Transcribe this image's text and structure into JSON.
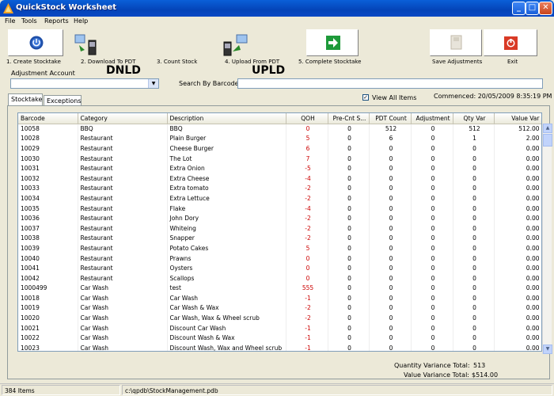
{
  "window": {
    "title": "QuickStock Worksheet"
  },
  "menu": [
    "File",
    "Tools",
    "Reports",
    "Help"
  ],
  "toolbar": {
    "create": "1. Create Stocktake",
    "download": "2. Download To PDT",
    "download_big": "DNLD",
    "count": "3. Count Stock",
    "upload": "4. Upload From PDT",
    "upload_big": "UPLD",
    "complete": "5. Complete Stocktake",
    "save": "Save Adjustments",
    "exit": "Exit"
  },
  "form": {
    "adjustment_account_label": "Adjustment Account",
    "adjustment_account_value": "",
    "search_label": "Search By Barcode",
    "search_value": ""
  },
  "tabs": [
    "Stocktake",
    "Exceptions"
  ],
  "view_all": {
    "label": "View All Items",
    "checked": true
  },
  "commenced": "Commenced:  20/05/2009 8:35:19 PM",
  "table": {
    "headers": [
      "Barcode",
      "Category",
      "Description",
      "QOH",
      "Pre-Cnt S...",
      "PDT Count",
      "Adjustment",
      "Qty Var",
      "Value Var"
    ],
    "rows": [
      [
        "10058",
        "BBQ",
        "BBQ",
        "0",
        "0",
        "512",
        "0",
        "512",
        "512.00"
      ],
      [
        "10028",
        "Restaurant",
        "Plain Burger",
        "5",
        "0",
        "6",
        "0",
        "1",
        "2.00"
      ],
      [
        "10029",
        "Restaurant",
        "Cheese Burger",
        "6",
        "0",
        "0",
        "0",
        "0",
        "0.00"
      ],
      [
        "10030",
        "Restaurant",
        "The Lot",
        "7",
        "0",
        "0",
        "0",
        "0",
        "0.00"
      ],
      [
        "10031",
        "Restaurant",
        "Extra Onion",
        "-5",
        "0",
        "0",
        "0",
        "0",
        "0.00"
      ],
      [
        "10032",
        "Restaurant",
        "Extra Cheese",
        "-4",
        "0",
        "0",
        "0",
        "0",
        "0.00"
      ],
      [
        "10033",
        "Restaurant",
        "Extra tomato",
        "-2",
        "0",
        "0",
        "0",
        "0",
        "0.00"
      ],
      [
        "10034",
        "Restaurant",
        "Extra Lettuce",
        "-2",
        "0",
        "0",
        "0",
        "0",
        "0.00"
      ],
      [
        "10035",
        "Restaurant",
        "Flake",
        "-4",
        "0",
        "0",
        "0",
        "0",
        "0.00"
      ],
      [
        "10036",
        "Restaurant",
        "John Dory",
        "-2",
        "0",
        "0",
        "0",
        "0",
        "0.00"
      ],
      [
        "10037",
        "Restaurant",
        "Whiteing",
        "-2",
        "0",
        "0",
        "0",
        "0",
        "0.00"
      ],
      [
        "10038",
        "Restaurant",
        "Snapper",
        "-2",
        "0",
        "0",
        "0",
        "0",
        "0.00"
      ],
      [
        "10039",
        "Restaurant",
        "Potato Cakes",
        "5",
        "0",
        "0",
        "0",
        "0",
        "0.00"
      ],
      [
        "10040",
        "Restaurant",
        "Prawns",
        "0",
        "0",
        "0",
        "0",
        "0",
        "0.00"
      ],
      [
        "10041",
        "Restaurant",
        "Oysters",
        "0",
        "0",
        "0",
        "0",
        "0",
        "0.00"
      ],
      [
        "10042",
        "Restaurant",
        "Scallops",
        "0",
        "0",
        "0",
        "0",
        "0",
        "0.00"
      ],
      [
        "1000499",
        "Car Wash",
        "test",
        "555",
        "0",
        "0",
        "0",
        "0",
        "0.00"
      ],
      [
        "10018",
        "Car Wash",
        "Car Wash",
        "-1",
        "0",
        "0",
        "0",
        "0",
        "0.00"
      ],
      [
        "10019",
        "Car Wash",
        "Car Wash & Wax",
        "-2",
        "0",
        "0",
        "0",
        "0",
        "0.00"
      ],
      [
        "10020",
        "Car Wash",
        "Car Wash, Wax & Wheel scrub",
        "-2",
        "0",
        "0",
        "0",
        "0",
        "0.00"
      ],
      [
        "10021",
        "Car Wash",
        "Discount Car Wash",
        "-1",
        "0",
        "0",
        "0",
        "0",
        "0.00"
      ],
      [
        "10022",
        "Car Wash",
        "Discount Wash & Wax",
        "-1",
        "0",
        "0",
        "0",
        "0",
        "0.00"
      ],
      [
        "10023",
        "Car Wash",
        "Discount Wash, Wax and Wheel scrub",
        "-1",
        "0",
        "0",
        "0",
        "0",
        "0.00"
      ]
    ]
  },
  "totals": {
    "qty_label": "Quantity Variance Total:",
    "qty_value": "513",
    "value_label": "Value Variance Total:",
    "value_value": "$514.00"
  },
  "status": {
    "items": "384 Items",
    "path": "c:\\qpdb\\StockManagement.pdb"
  },
  "colors": {
    "accent": "#0a5fd8",
    "negative": "#cc0000"
  }
}
